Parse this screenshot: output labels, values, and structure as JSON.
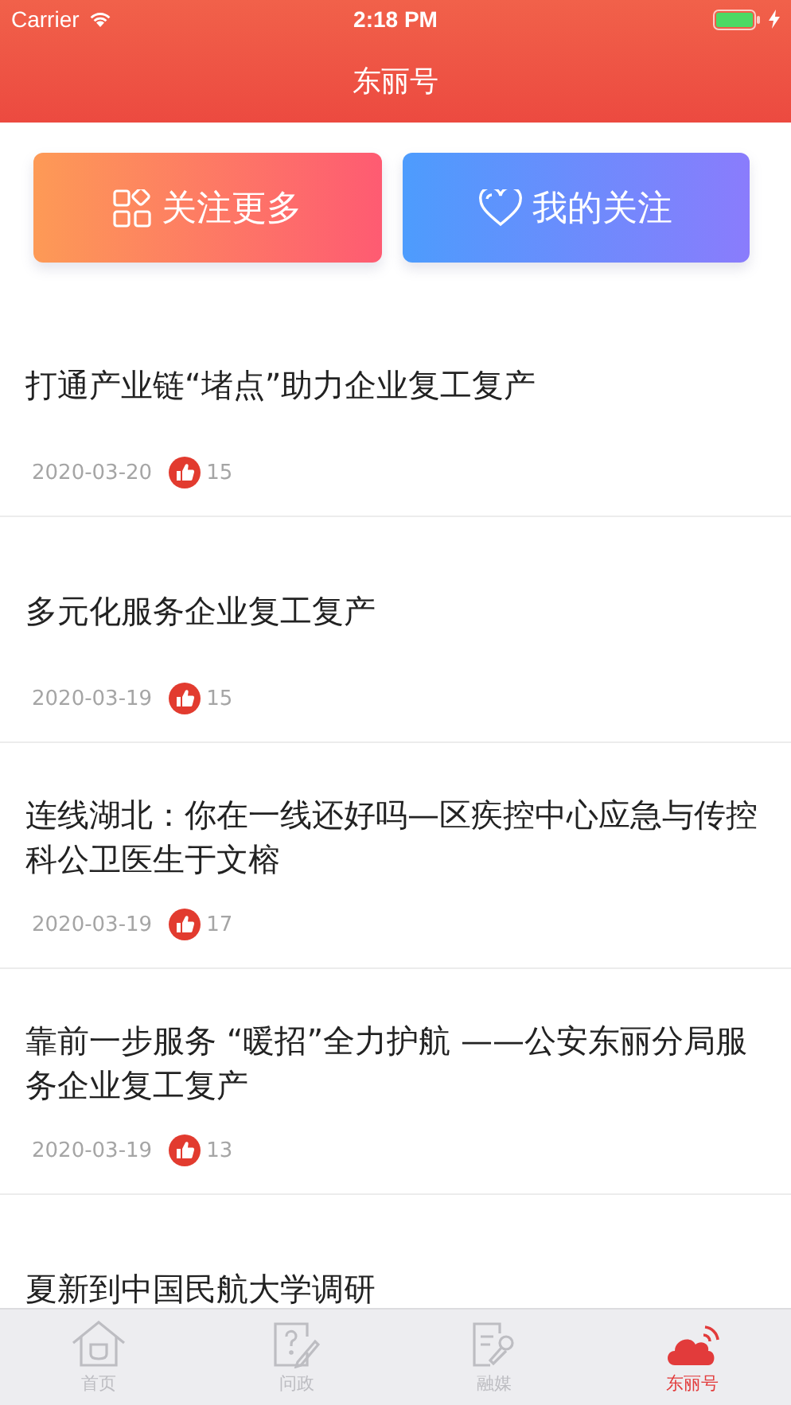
{
  "status_bar": {
    "carrier": "Carrier",
    "time": "2:18 PM",
    "charging": true
  },
  "nav": {
    "title": "东丽号"
  },
  "actions": [
    {
      "kind": "grid",
      "label": "关注更多"
    },
    {
      "kind": "heart",
      "label": "我的关注"
    }
  ],
  "articles": [
    {
      "title": "打通产业链“堵点”助力企业复工复产",
      "date": "2020-03-20",
      "likes": "15"
    },
    {
      "title": "多元化服务企业复工复产",
      "date": "2020-03-19",
      "likes": "15"
    },
    {
      "title": "连线湖北：你在一线还好吗—区疾控中心应急与传控科公卫医生于文榕",
      "date": "2020-03-19",
      "likes": "17"
    },
    {
      "title": "靠前一步服务 “暖招”全力护航 ——公安东丽分局服务企业复工复产",
      "date": "2020-03-19",
      "likes": "13"
    },
    {
      "title": "夏新到中国民航大学调研"
    }
  ],
  "tabs": [
    {
      "kind": "home",
      "label": "首页",
      "selected": false
    },
    {
      "kind": "ask",
      "label": "问政",
      "selected": false
    },
    {
      "kind": "media",
      "label": "融媒",
      "selected": false
    },
    {
      "kind": "cloud",
      "label": "东丽号",
      "selected": true
    }
  ]
}
